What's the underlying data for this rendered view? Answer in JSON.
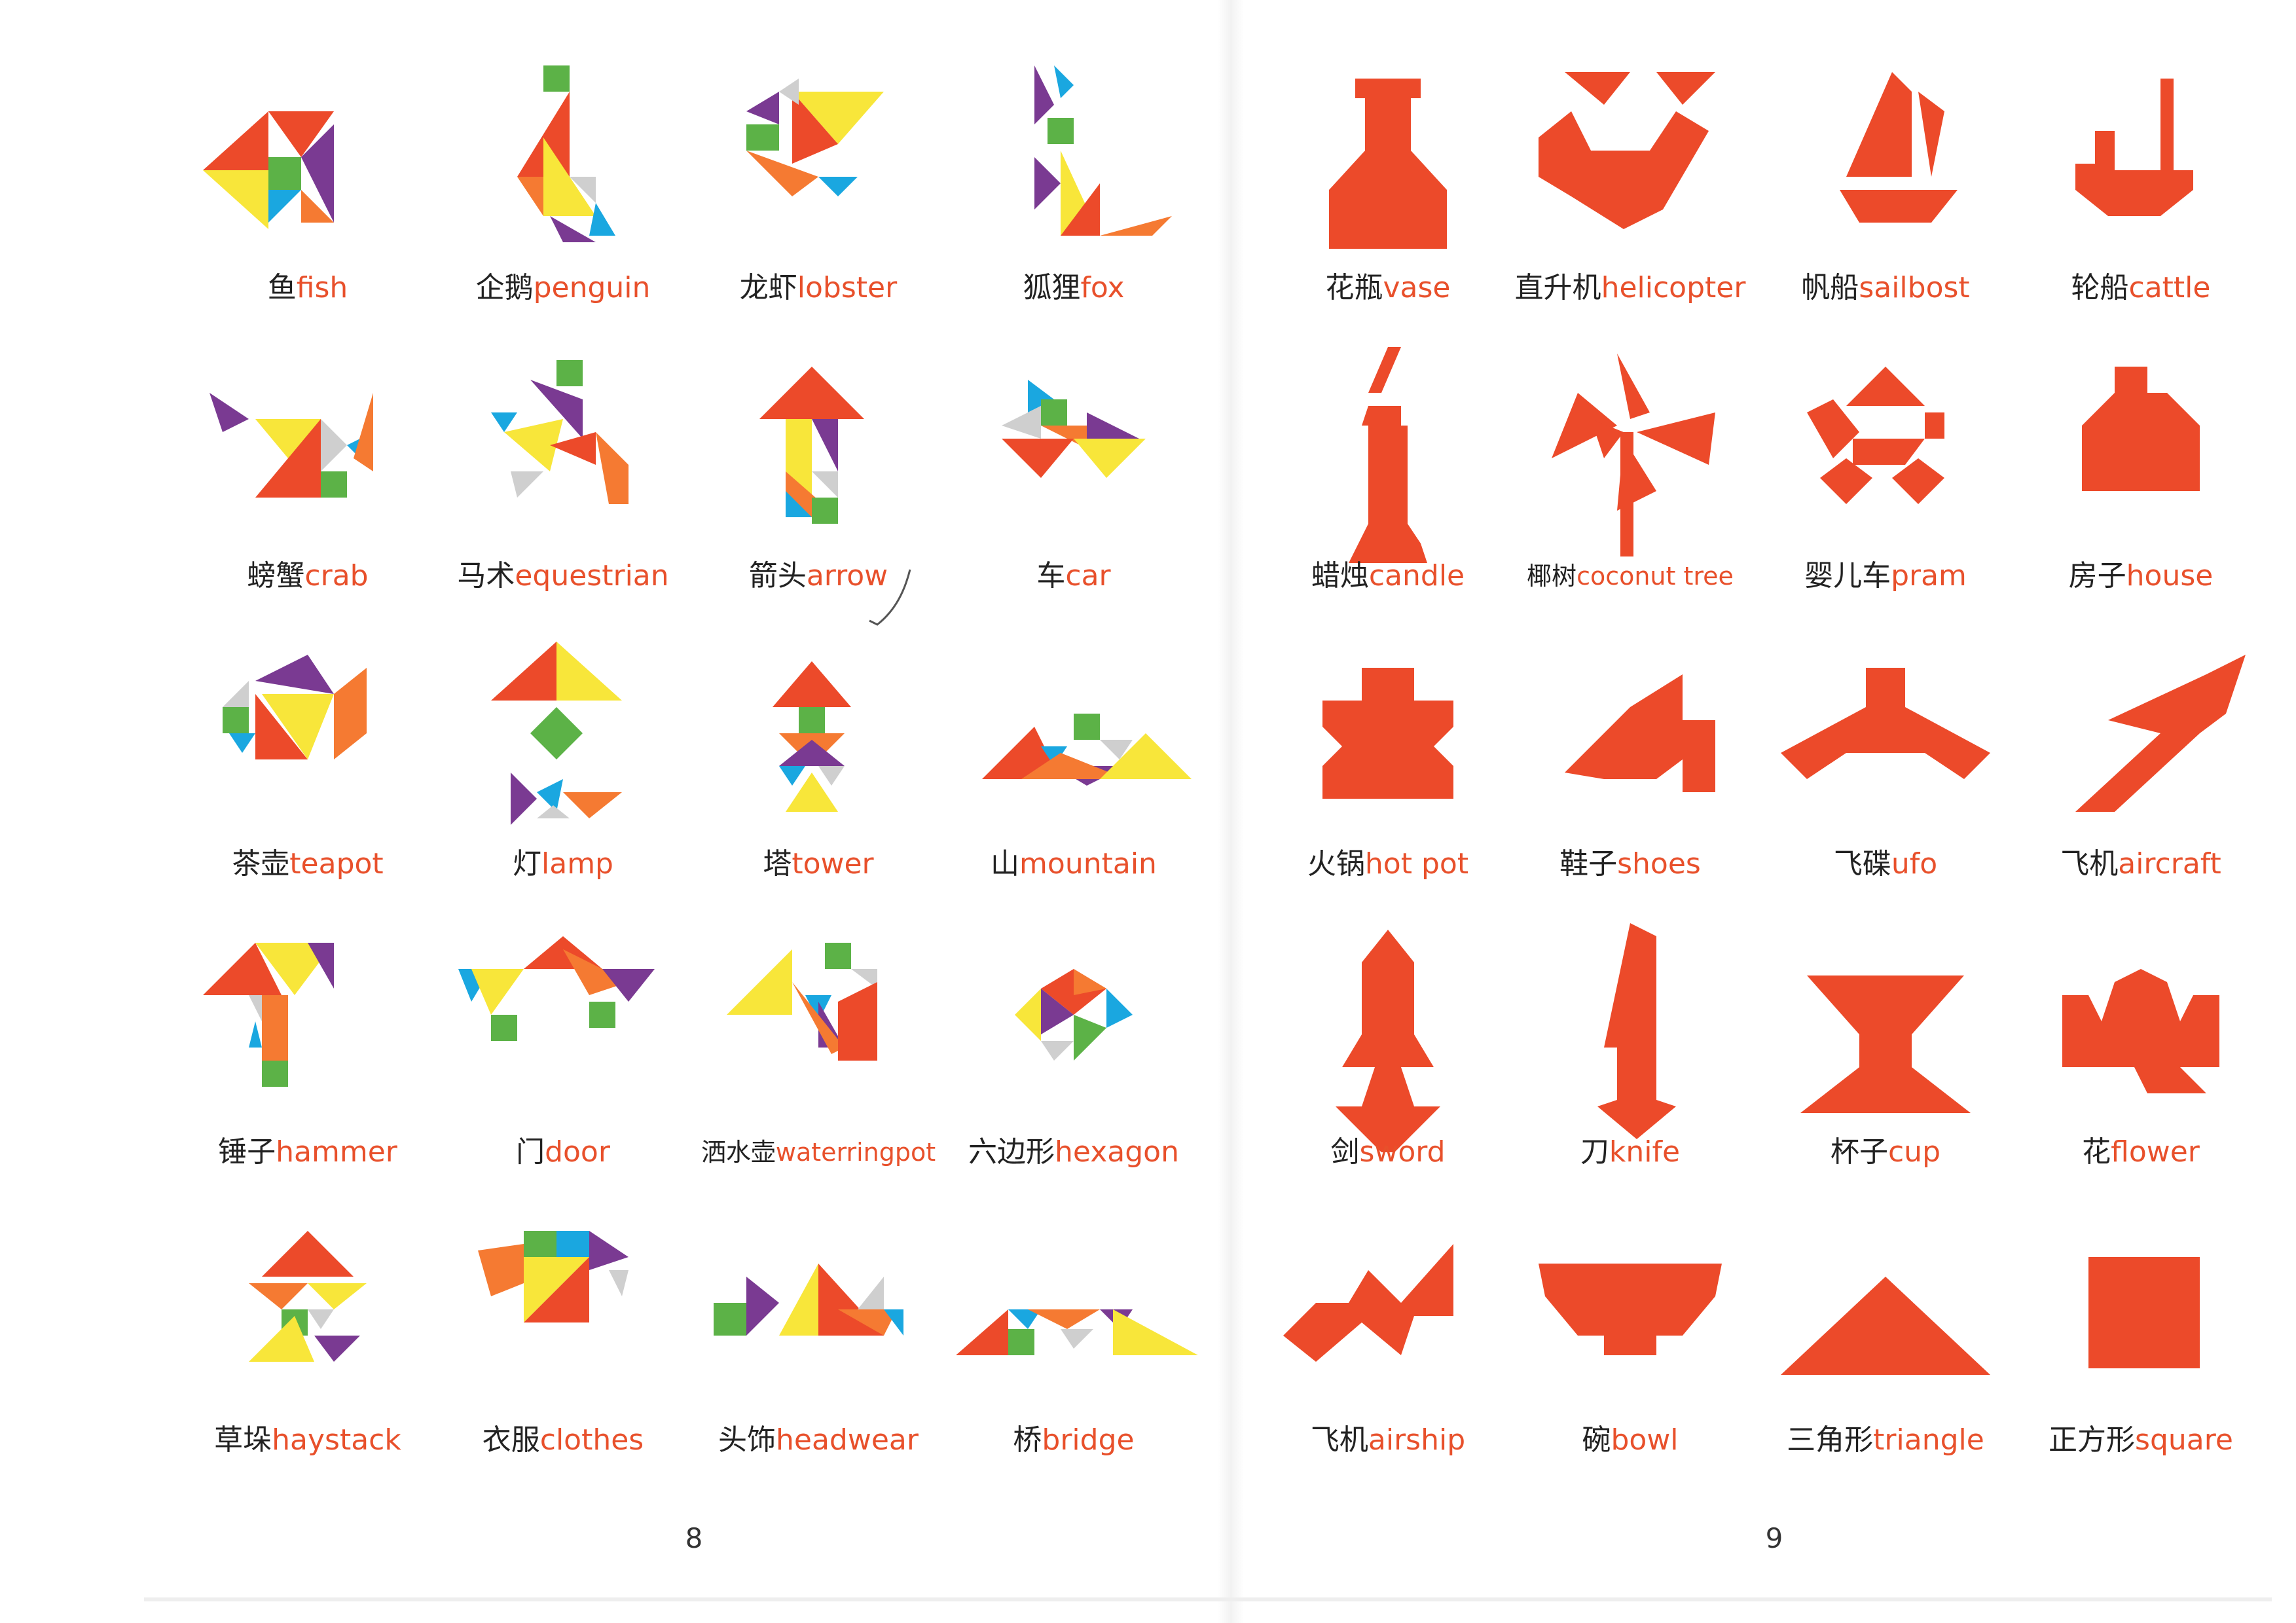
{
  "left_page": {
    "page_number": "8",
    "items": [
      {
        "zh": "鱼",
        "en": "fish",
        "shape": "fish"
      },
      {
        "zh": "企鹅",
        "en": "penguin",
        "shape": "penguin"
      },
      {
        "zh": "龙虾",
        "en": "lobster",
        "shape": "lobster"
      },
      {
        "zh": "狐狸",
        "en": "fox",
        "shape": "fox"
      },
      {
        "zh": "螃蟹",
        "en": "crab",
        "shape": "crab"
      },
      {
        "zh": "马术",
        "en": "equestrian",
        "shape": "equestrian"
      },
      {
        "zh": "箭头",
        "en": "arrow",
        "shape": "arrow"
      },
      {
        "zh": "车",
        "en": "car",
        "shape": "car"
      },
      {
        "zh": "茶壶",
        "en": "teapot",
        "shape": "teapot"
      },
      {
        "zh": "灯",
        "en": "lamp",
        "shape": "lamp"
      },
      {
        "zh": "塔",
        "en": "tower",
        "shape": "tower"
      },
      {
        "zh": "山",
        "en": "mountain",
        "shape": "mountain"
      },
      {
        "zh": "锤子",
        "en": "hammer",
        "shape": "hammer"
      },
      {
        "zh": "门",
        "en": "door",
        "shape": "door"
      },
      {
        "zh": "洒水壶",
        "en": "waterringpot",
        "shape": "waterringpot"
      },
      {
        "zh": "六边形",
        "en": "hexagon",
        "shape": "hexagon"
      },
      {
        "zh": "草垛",
        "en": "haystack",
        "shape": "haystack"
      },
      {
        "zh": "衣服",
        "en": "clothes",
        "shape": "clothes"
      },
      {
        "zh": "头饰",
        "en": "headwear",
        "shape": "headwear"
      },
      {
        "zh": "桥",
        "en": "bridge",
        "shape": "bridge"
      }
    ]
  },
  "right_page": {
    "page_number": "9",
    "items": [
      {
        "zh": "花瓶",
        "en": "vase",
        "shape": "vase"
      },
      {
        "zh": "直升机",
        "en": "helicopter",
        "shape": "helicopter"
      },
      {
        "zh": "帆船",
        "en": "sailbost",
        "shape": "sailboat"
      },
      {
        "zh": "轮船",
        "en": "cattle",
        "shape": "steamer"
      },
      {
        "zh": "蜡烛",
        "en": "candle",
        "shape": "candle"
      },
      {
        "zh": "椰树",
        "en": "coconut tree",
        "shape": "coconut-tree"
      },
      {
        "zh": "婴儿车",
        "en": "pram",
        "shape": "pram"
      },
      {
        "zh": "房子",
        "en": "house",
        "shape": "house"
      },
      {
        "zh": "火锅",
        "en": "hot pot",
        "shape": "hot-pot"
      },
      {
        "zh": "鞋子",
        "en": "shoes",
        "shape": "shoes"
      },
      {
        "zh": "飞碟",
        "en": "ufo",
        "shape": "ufo"
      },
      {
        "zh": "飞机",
        "en": "aircraft",
        "shape": "aircraft"
      },
      {
        "zh": "剑",
        "en": "sword",
        "shape": "sword"
      },
      {
        "zh": "刀",
        "en": "knife",
        "shape": "knife"
      },
      {
        "zh": "杯子",
        "en": "cup",
        "shape": "cup"
      },
      {
        "zh": "花",
        "en": "flower",
        "shape": "flower"
      },
      {
        "zh": "飞机",
        "en": "airship",
        "shape": "airship"
      },
      {
        "zh": "碗",
        "en": "bowl",
        "shape": "bowl"
      },
      {
        "zh": "三角形",
        "en": "triangle",
        "shape": "triangle"
      },
      {
        "zh": "正方形",
        "en": "square",
        "shape": "square"
      }
    ]
  },
  "colors": {
    "tangram_red": "#ec4a2a",
    "tangram_yellow": "#f8e63a",
    "tangram_green": "#5cb247",
    "tangram_purple": "#7a3a92",
    "tangram_blue": "#1aa7e0",
    "tangram_orange": "#f57a32",
    "tangram_grey": "#cfcfcf",
    "caption_english": "#e8502b"
  }
}
